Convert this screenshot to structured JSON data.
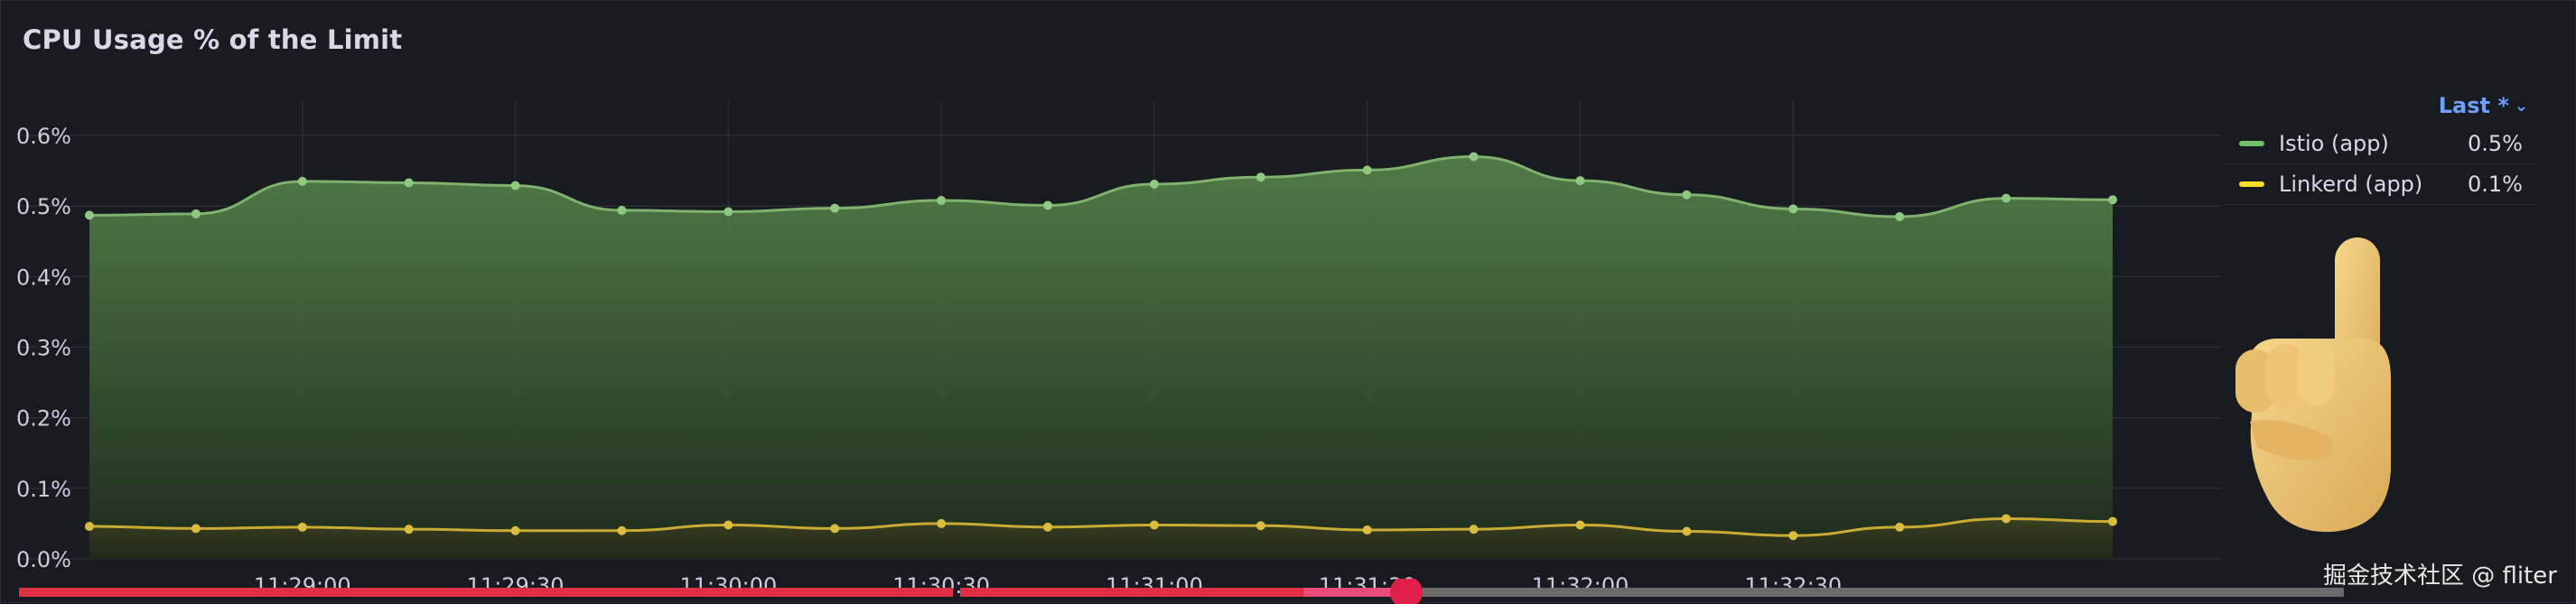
{
  "panel": {
    "title": "CPU Usage % of the Limit"
  },
  "legend": {
    "header_label": "Last *",
    "items": [
      {
        "name": "Istio (app)",
        "value": "0.5%",
        "color": "#73bf69"
      },
      {
        "name": "Linkerd (app)",
        "value": "0.1%",
        "color": "#fade2a"
      }
    ]
  },
  "watermark": "掘金技术社区 @ fliter",
  "icons": {
    "legend_chevron": "chevron-down-icon",
    "pointing_hand": "pointing-up-hand-icon"
  },
  "colors": {
    "istio_line": "#7eb26d",
    "linkerd_line": "#c9ab34",
    "scrubber_played": "#e02f44",
    "scrubber_buffer": "#555",
    "scrubber_knob": "#e0204a"
  },
  "chart_data": {
    "type": "area",
    "title": "CPU Usage % of the Limit",
    "xlabel": "",
    "ylabel": "",
    "ylim": [
      0,
      0.65
    ],
    "yticks": [
      "0.0%",
      "0.1%",
      "0.2%",
      "0.3%",
      "0.4%",
      "0.5%",
      "0.6%"
    ],
    "ytick_values": [
      0,
      0.1,
      0.2,
      0.3,
      0.4,
      0.5,
      0.6
    ],
    "xticks": [
      "11:29:00",
      "11:29:30",
      "11:30:00",
      "11:30:30",
      "11:31:00",
      "11:31:30",
      "11:32:00",
      "11:32:30"
    ],
    "xtick_seconds": [
      30,
      60,
      90,
      120,
      150,
      180,
      210,
      240
    ],
    "x_seconds": [
      0,
      15,
      30,
      45,
      60,
      75,
      90,
      105,
      120,
      135,
      150,
      165,
      180,
      195,
      210,
      225,
      240,
      255,
      270,
      285
    ],
    "xlim": [
      0,
      285
    ],
    "grid": true,
    "legend_placement": "right",
    "series": [
      {
        "name": "Istio (app)",
        "values": [
          0.487,
          0.489,
          0.535,
          0.533,
          0.529,
          0.494,
          0.492,
          0.497,
          0.508,
          0.501,
          0.531,
          0.541,
          0.551,
          0.57,
          0.536,
          0.516,
          0.496,
          0.485,
          0.511,
          0.509
        ]
      },
      {
        "name": "Linkerd (app)",
        "values": [
          0.046,
          0.043,
          0.045,
          0.042,
          0.04,
          0.04,
          0.048,
          0.043,
          0.05,
          0.045,
          0.048,
          0.047,
          0.041,
          0.042,
          0.048,
          0.039,
          0.033,
          0.045,
          0.057,
          0.053
        ]
      }
    ]
  }
}
